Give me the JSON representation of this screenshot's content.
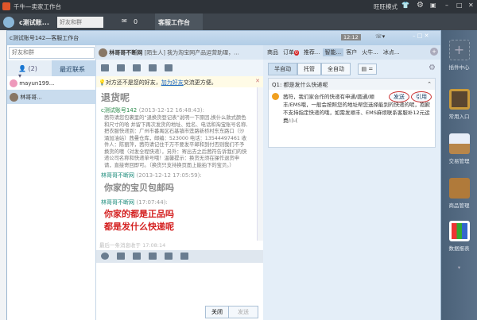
{
  "app": {
    "title": "千牛—卖家工作台"
  },
  "titlebar": {
    "mode": "旺旺模式"
  },
  "toolbar": {
    "account": "c测试账...",
    "search_placeholder": "好友和群",
    "mail_count": "0",
    "workbench": "客服工作台"
  },
  "window": {
    "title": "c测试账号142—客服工作台",
    "time_badge": "12:12"
  },
  "left": {
    "search_placeholder": "好友和群",
    "group_count": "(2)",
    "recent_tab": "最近联系",
    "contacts": [
      {
        "name": "mayun199..."
      },
      {
        "name": "林哥哥..."
      }
    ]
  },
  "chat": {
    "contact_name": "林哥哥不断网",
    "contact_status": "[陌生人]",
    "contact_sig": "我为淘宝网产品运营助理，...",
    "notice_pre": "对方还不是您的好友，",
    "notice_link": "加为好友",
    "notice_post": "交流更方便。",
    "messages": [
      {
        "text": "退货呢",
        "style": "big-gray"
      },
      {
        "name": "c测试账号142",
        "time": "(2013-12-12 16:48:43):",
        "text": "茜符请您包裹里的“退换货登记表”说明一下原因,换什么款式颜色和尺寸的哈 并留下再次发货的地址、姓名、电话和淘宝账号名称,把衣服快递到：广州市番禺区石基镇市莲路新桥村东东路口（沙涌加油站）茜曼仓库，邮编：523000 电话：13544497461 收件人：陈丽萍，茜符请记住千万不要发平邮和到付否则我们不予换货的噢（对发全程快递），另外：寄出去之后茜符告诉我们的快递公司名称和快递单号哦！温馨提示：换货无须在操作退货申请，直接寄回即可。（换货只支持换页面上能拍下的宝贝。）",
        "style": "small"
      },
      {
        "name": "林哥哥不断网",
        "time": "(2013-12-12 17:05:59):",
        "text": "你家的宝贝包邮吗",
        "style": "big-gray"
      },
      {
        "name": "林哥哥不断网",
        "time": "(17:07:44):",
        "text": "你家的都是正品吗\n都是发什么快递呢",
        "style": "big-red"
      }
    ],
    "last_msg": "最后一条消息收于 17:08:14",
    "close_btn": "关闭",
    "send_btn": "发送"
  },
  "right": {
    "tabs": [
      "商品",
      "订单",
      "推荐...",
      "智能...",
      "客户",
      "火牛...",
      "冰点..."
    ],
    "order_badge": "0",
    "modes": [
      "半自动",
      "托管",
      "全自动"
    ],
    "question": "Q1: 都是发什么快递呢",
    "answer": "茜符，我们家合作的快递有申通/圆通/顺丰/EMS哦，一般会按照您的地址帮您选择能到的快递的呢，抱歉不支持指定快递的哦，如需发顺丰、EMS麻烦联系客服补12元运费/:)-(",
    "send": "发送",
    "quote": "引用"
  },
  "sidebar": {
    "items": [
      "插件中心",
      "常用入口",
      "交易管理",
      "商品管理",
      "数据报表"
    ]
  },
  "colors": {
    "red": "#d42020",
    "green": "#2a8a4a",
    "link": "#1a66c0"
  }
}
